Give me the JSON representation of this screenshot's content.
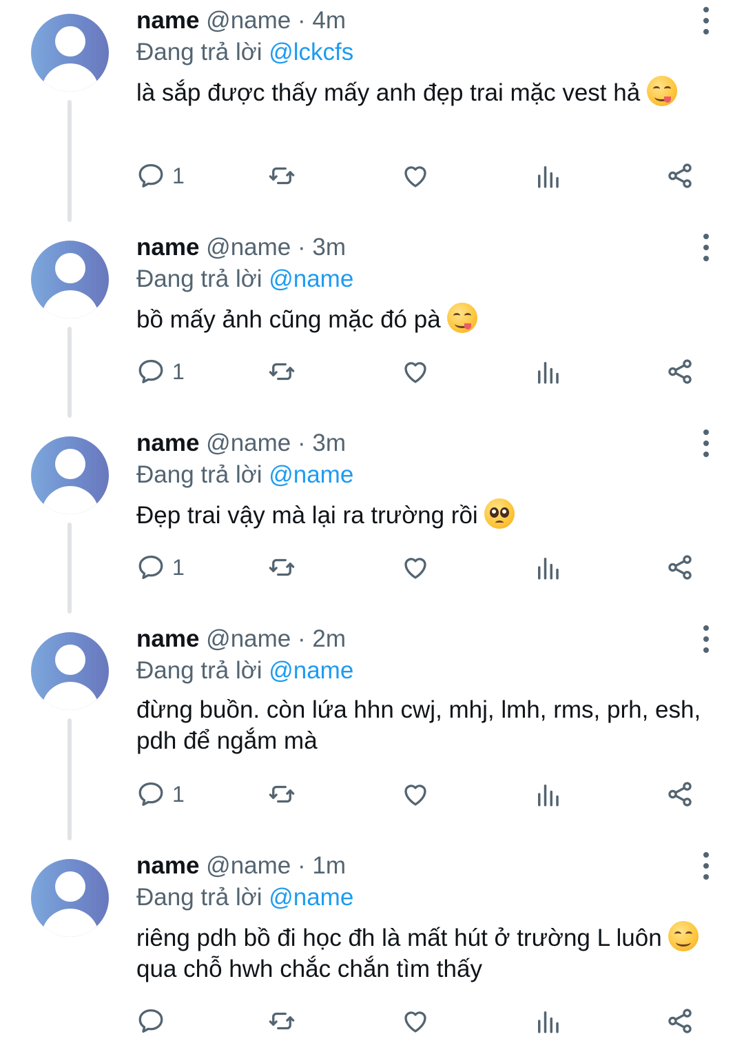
{
  "tweets": [
    {
      "name": "name",
      "handle": "@name",
      "time": "· 4m",
      "reply_prefix": "Đang trả lời",
      "reply_to": "@lckcfs",
      "text": "là sắp được thấy mấy anh đẹp trai mặc vest hả",
      "text_after": "",
      "emoji": "yum-emoji",
      "reply_count": "1"
    },
    {
      "name": "name",
      "handle": "@name",
      "time": "· 3m",
      "reply_prefix": "Đang trả lời",
      "reply_to": "@name",
      "text": "bồ mấy ảnh cũng mặc đó pà",
      "text_after": "",
      "emoji": "yum-emoji",
      "reply_count": "1"
    },
    {
      "name": "name",
      "handle": "@name",
      "time": "· 3m",
      "reply_prefix": "Đang trả lời",
      "reply_to": "@name",
      "text": "Đẹp trai vậy mà lại ra trường rồi",
      "text_after": "",
      "emoji": "pleading-emoji",
      "reply_count": "1"
    },
    {
      "name": "name",
      "handle": "@name",
      "time": "· 2m",
      "reply_prefix": "Đang trả lời",
      "reply_to": "@name",
      "text": "đừng buồn. còn lứa hhn cwj, mhj, lmh, rms, prh, esh, pdh để ngắm mà",
      "text_after": "",
      "emoji": "",
      "reply_count": "1"
    },
    {
      "name": "name",
      "handle": "@name",
      "time": "· 1m",
      "reply_prefix": "Đang trả lời",
      "reply_to": "@name",
      "text": "riêng pdh bồ đi học đh là mất hút ở trường L luôn",
      "text_after": "qua chỗ hwh chắc chắn tìm thấy",
      "emoji": "blush-emoji",
      "reply_count": ""
    }
  ],
  "icons": {
    "reply": "reply-icon",
    "retweet": "retweet-icon",
    "like": "heart-icon",
    "views": "views-icon",
    "share": "share-icon",
    "more": "more-icon"
  },
  "colors": {
    "text": "#0f1419",
    "secondary": "#536471",
    "link": "#1d9bf0",
    "thread_line": "#e1e3e6"
  }
}
